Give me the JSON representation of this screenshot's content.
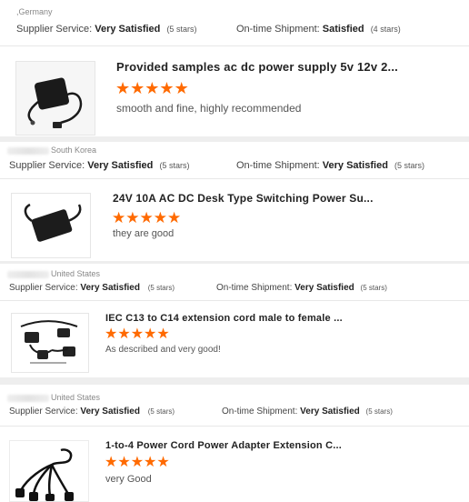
{
  "reviews": [
    {
      "country": ",Germany",
      "supplier_label": "Supplier Service:",
      "supplier_value": "Very Satisfied",
      "supplier_count": "(5 stars)",
      "shipment_label": "On-time Shipment:",
      "shipment_value": "Satisfied",
      "shipment_count": "(4 stars)",
      "title": "Provided samples ac dc power supply 5v 12v 2...",
      "stars": 5,
      "comment": "smooth and fine, highly recommended"
    },
    {
      "country": "South Korea",
      "supplier_label": "Supplier Service:",
      "supplier_value": "Very Satisfied",
      "supplier_count": "(5 stars)",
      "shipment_label": "On-time Shipment:",
      "shipment_value": "Very Satisfied",
      "shipment_count": "(5 stars)",
      "title": "24V 10A AC DC Desk Type Switching Power Su...",
      "stars": 5,
      "comment": "they are good"
    },
    {
      "country": "United States",
      "supplier_label": "Supplier Service:",
      "supplier_value": "Very Satisfied",
      "supplier_count": "(5 stars)",
      "shipment_label": "On-time Shipment:",
      "shipment_value": "Very Satisfied",
      "shipment_count": "(5 stars)",
      "title": "IEC C13 to C14 extension cord male to female ...",
      "stars": 5,
      "comment": "As described and very good!"
    },
    {
      "country": "United States",
      "supplier_label": "Supplier Service:",
      "supplier_value": "Very Satisfied",
      "supplier_count": "(5 stars)",
      "shipment_label": "On-time Shipment:",
      "shipment_value": "Very Satisfied",
      "shipment_count": "(5 stars)",
      "title": "1-to-4 Power Cord Power Adapter Extension C...",
      "stars": 5,
      "comment": "very Good"
    }
  ],
  "colors": {
    "star": "#ff6a00"
  },
  "icons": [
    "star-icon",
    "product-image-adapter",
    "product-image-desk-adapter",
    "product-image-extension-cords",
    "product-image-splitter-cord"
  ]
}
